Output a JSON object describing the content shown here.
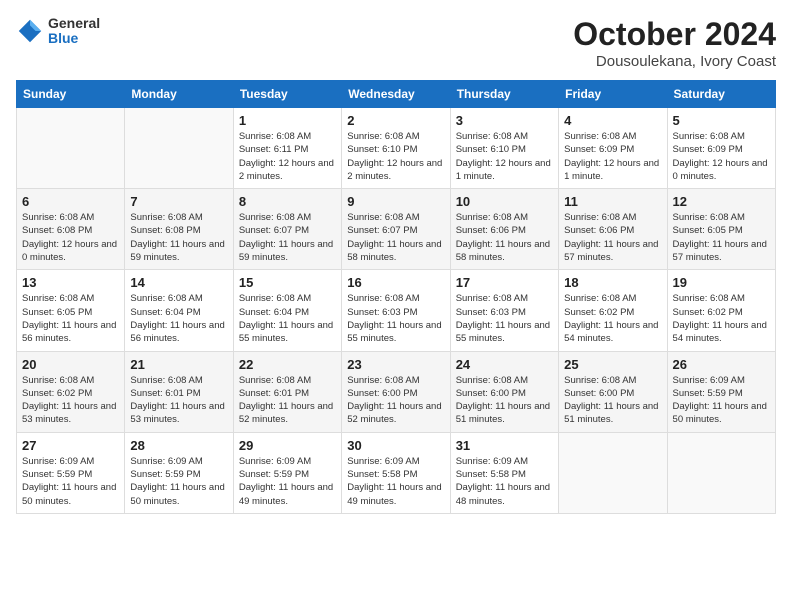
{
  "header": {
    "logo_general": "General",
    "logo_blue": "Blue",
    "title": "October 2024",
    "subtitle": "Dousoulekana, Ivory Coast"
  },
  "calendar": {
    "days_of_week": [
      "Sunday",
      "Monday",
      "Tuesday",
      "Wednesday",
      "Thursday",
      "Friday",
      "Saturday"
    ],
    "weeks": [
      [
        {
          "day": "",
          "info": ""
        },
        {
          "day": "",
          "info": ""
        },
        {
          "day": "1",
          "info": "Sunrise: 6:08 AM\nSunset: 6:11 PM\nDaylight: 12 hours and 2 minutes."
        },
        {
          "day": "2",
          "info": "Sunrise: 6:08 AM\nSunset: 6:10 PM\nDaylight: 12 hours and 2 minutes."
        },
        {
          "day": "3",
          "info": "Sunrise: 6:08 AM\nSunset: 6:10 PM\nDaylight: 12 hours and 1 minute."
        },
        {
          "day": "4",
          "info": "Sunrise: 6:08 AM\nSunset: 6:09 PM\nDaylight: 12 hours and 1 minute."
        },
        {
          "day": "5",
          "info": "Sunrise: 6:08 AM\nSunset: 6:09 PM\nDaylight: 12 hours and 0 minutes."
        }
      ],
      [
        {
          "day": "6",
          "info": "Sunrise: 6:08 AM\nSunset: 6:08 PM\nDaylight: 12 hours and 0 minutes."
        },
        {
          "day": "7",
          "info": "Sunrise: 6:08 AM\nSunset: 6:08 PM\nDaylight: 11 hours and 59 minutes."
        },
        {
          "day": "8",
          "info": "Sunrise: 6:08 AM\nSunset: 6:07 PM\nDaylight: 11 hours and 59 minutes."
        },
        {
          "day": "9",
          "info": "Sunrise: 6:08 AM\nSunset: 6:07 PM\nDaylight: 11 hours and 58 minutes."
        },
        {
          "day": "10",
          "info": "Sunrise: 6:08 AM\nSunset: 6:06 PM\nDaylight: 11 hours and 58 minutes."
        },
        {
          "day": "11",
          "info": "Sunrise: 6:08 AM\nSunset: 6:06 PM\nDaylight: 11 hours and 57 minutes."
        },
        {
          "day": "12",
          "info": "Sunrise: 6:08 AM\nSunset: 6:05 PM\nDaylight: 11 hours and 57 minutes."
        }
      ],
      [
        {
          "day": "13",
          "info": "Sunrise: 6:08 AM\nSunset: 6:05 PM\nDaylight: 11 hours and 56 minutes."
        },
        {
          "day": "14",
          "info": "Sunrise: 6:08 AM\nSunset: 6:04 PM\nDaylight: 11 hours and 56 minutes."
        },
        {
          "day": "15",
          "info": "Sunrise: 6:08 AM\nSunset: 6:04 PM\nDaylight: 11 hours and 55 minutes."
        },
        {
          "day": "16",
          "info": "Sunrise: 6:08 AM\nSunset: 6:03 PM\nDaylight: 11 hours and 55 minutes."
        },
        {
          "day": "17",
          "info": "Sunrise: 6:08 AM\nSunset: 6:03 PM\nDaylight: 11 hours and 55 minutes."
        },
        {
          "day": "18",
          "info": "Sunrise: 6:08 AM\nSunset: 6:02 PM\nDaylight: 11 hours and 54 minutes."
        },
        {
          "day": "19",
          "info": "Sunrise: 6:08 AM\nSunset: 6:02 PM\nDaylight: 11 hours and 54 minutes."
        }
      ],
      [
        {
          "day": "20",
          "info": "Sunrise: 6:08 AM\nSunset: 6:02 PM\nDaylight: 11 hours and 53 minutes."
        },
        {
          "day": "21",
          "info": "Sunrise: 6:08 AM\nSunset: 6:01 PM\nDaylight: 11 hours and 53 minutes."
        },
        {
          "day": "22",
          "info": "Sunrise: 6:08 AM\nSunset: 6:01 PM\nDaylight: 11 hours and 52 minutes."
        },
        {
          "day": "23",
          "info": "Sunrise: 6:08 AM\nSunset: 6:00 PM\nDaylight: 11 hours and 52 minutes."
        },
        {
          "day": "24",
          "info": "Sunrise: 6:08 AM\nSunset: 6:00 PM\nDaylight: 11 hours and 51 minutes."
        },
        {
          "day": "25",
          "info": "Sunrise: 6:08 AM\nSunset: 6:00 PM\nDaylight: 11 hours and 51 minutes."
        },
        {
          "day": "26",
          "info": "Sunrise: 6:09 AM\nSunset: 5:59 PM\nDaylight: 11 hours and 50 minutes."
        }
      ],
      [
        {
          "day": "27",
          "info": "Sunrise: 6:09 AM\nSunset: 5:59 PM\nDaylight: 11 hours and 50 minutes."
        },
        {
          "day": "28",
          "info": "Sunrise: 6:09 AM\nSunset: 5:59 PM\nDaylight: 11 hours and 50 minutes."
        },
        {
          "day": "29",
          "info": "Sunrise: 6:09 AM\nSunset: 5:59 PM\nDaylight: 11 hours and 49 minutes."
        },
        {
          "day": "30",
          "info": "Sunrise: 6:09 AM\nSunset: 5:58 PM\nDaylight: 11 hours and 49 minutes."
        },
        {
          "day": "31",
          "info": "Sunrise: 6:09 AM\nSunset: 5:58 PM\nDaylight: 11 hours and 48 minutes."
        },
        {
          "day": "",
          "info": ""
        },
        {
          "day": "",
          "info": ""
        }
      ]
    ]
  }
}
